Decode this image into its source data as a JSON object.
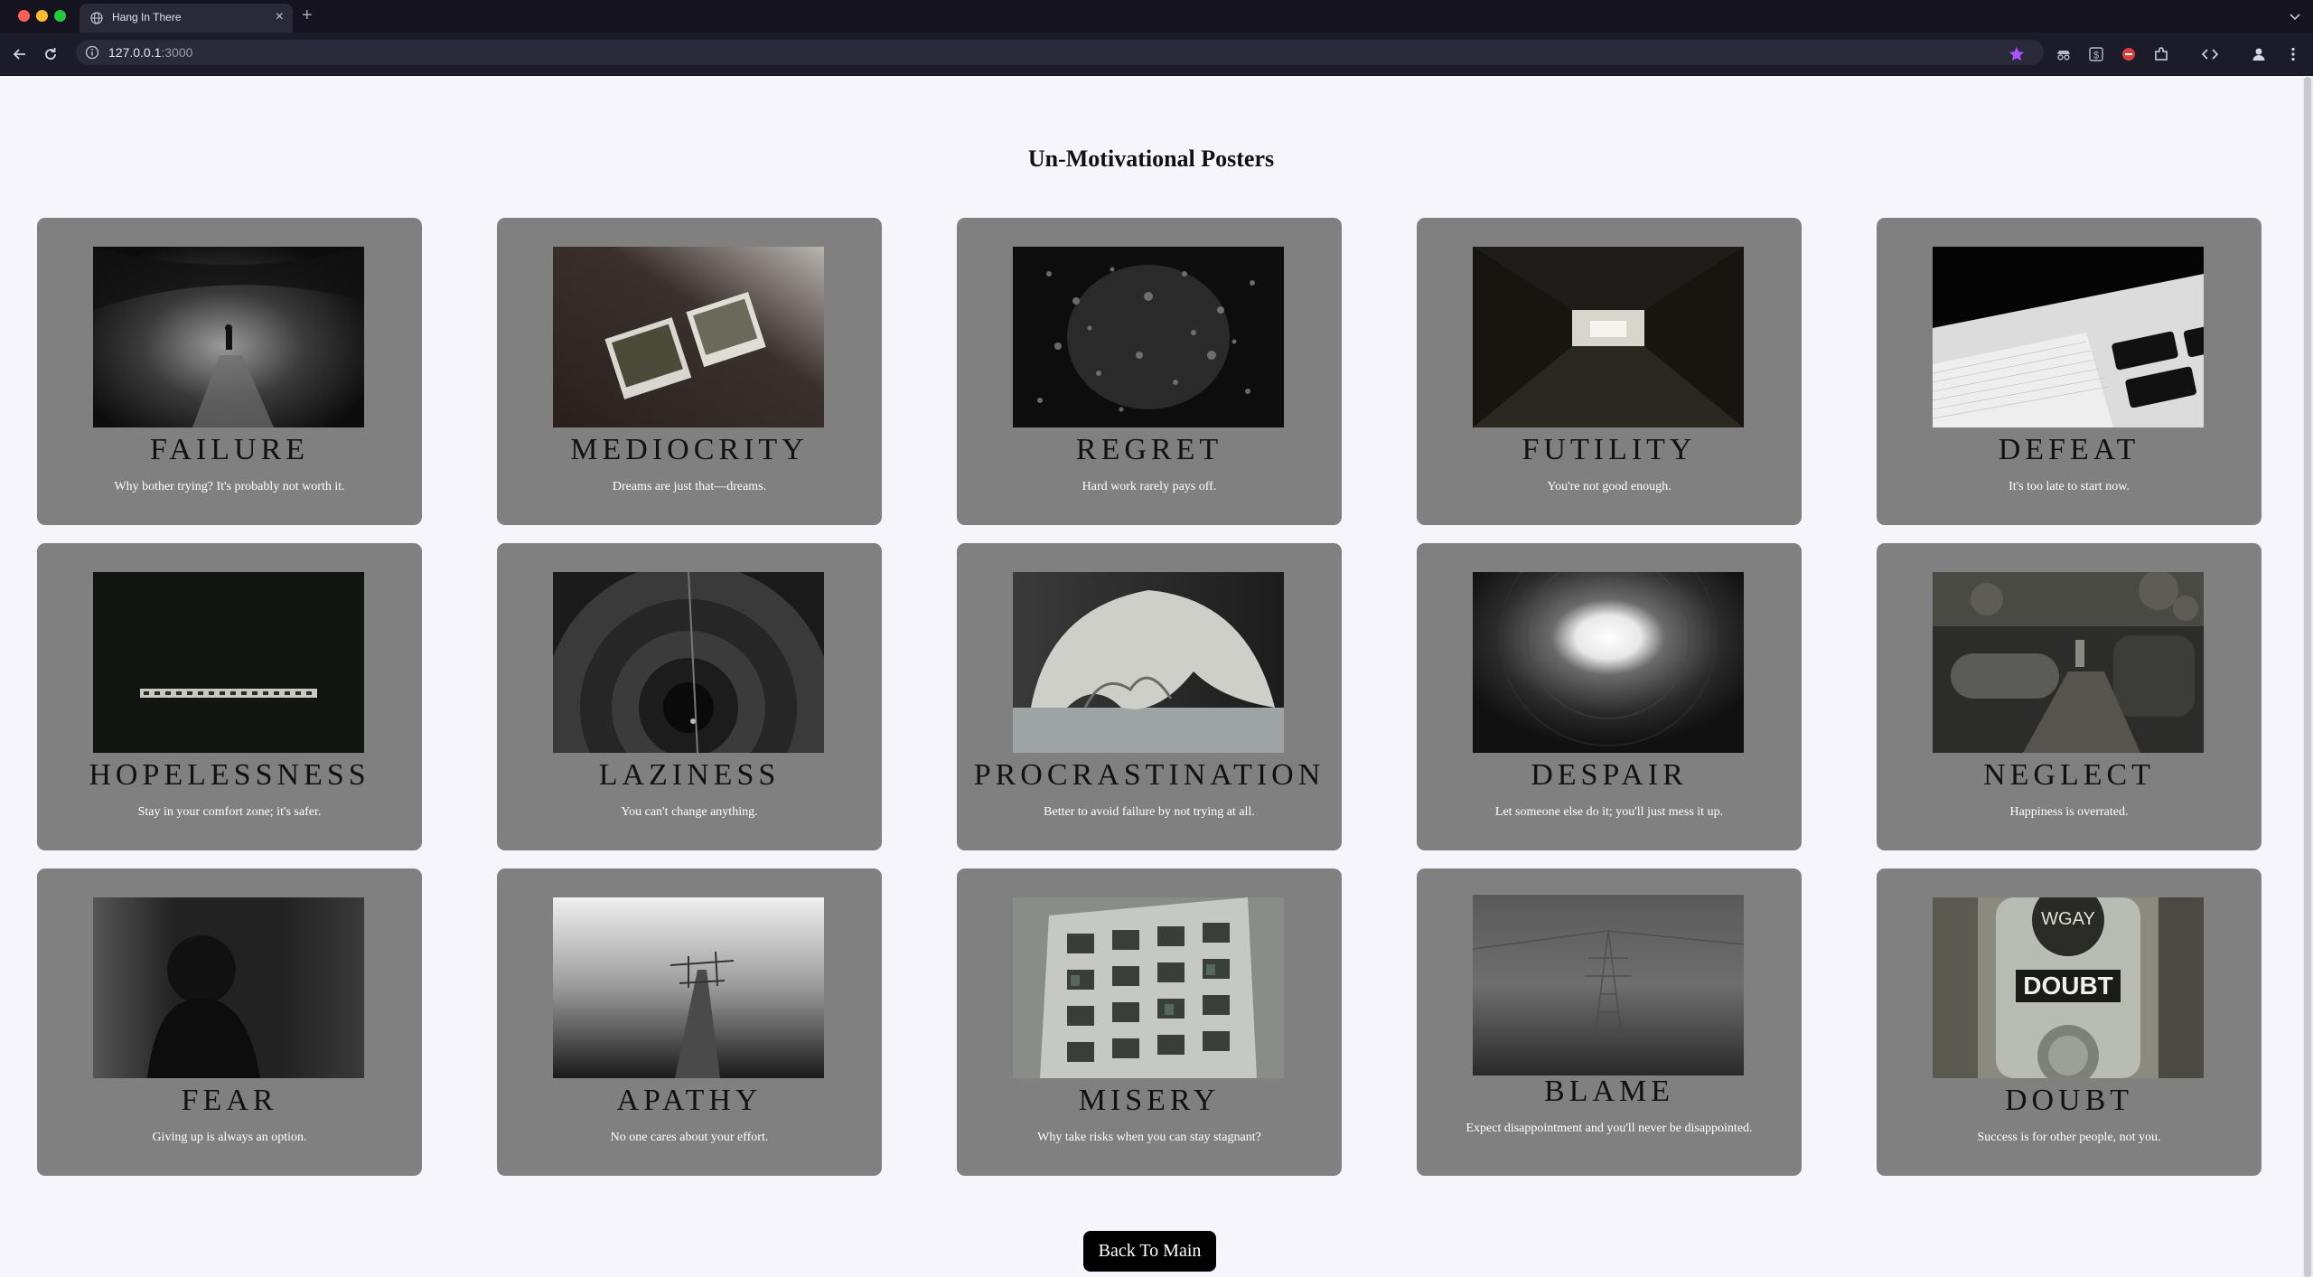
{
  "browser": {
    "tab_title": "Hang In There",
    "url_host": "127.0.0.1",
    "url_port": ":3000",
    "accent_color": "#a855f7"
  },
  "page": {
    "title": "Un-Motivational Posters",
    "back_button_label": "Back To Main"
  },
  "posters": [
    {
      "title": "FAILURE",
      "quote": "Why bother trying? It's probably not worth it.",
      "image": "dark-forest-path"
    },
    {
      "title": "MEDIOCRITY",
      "quote": "Dreams are just that—dreams.",
      "image": "two-polaroids"
    },
    {
      "title": "REGRET",
      "quote": "Hard work rarely pays off.",
      "image": "rain-drops-window"
    },
    {
      "title": "FUTILITY",
      "quote": "You're not good enough.",
      "image": "dark-tunnel"
    },
    {
      "title": "DEFEAT",
      "quote": "It's too late to start now.",
      "image": "laptop-keyboard"
    },
    {
      "title": "HOPELESSNESS",
      "quote": "Stay in your comfort zone; it's safer.",
      "image": "hopelessness-tiles"
    },
    {
      "title": "LAZINESS",
      "quote": "You can't change anything.",
      "image": "spiral-pit"
    },
    {
      "title": "PROCRASTINATION",
      "quote": "Better to avoid failure by not trying at all.",
      "image": "broken-eggshell"
    },
    {
      "title": "DESPAIR",
      "quote": "Let someone else do it; you'll just mess it up.",
      "image": "well-looking-up"
    },
    {
      "title": "NEGLECT",
      "quote": "Happiness is overrated.",
      "image": "abandoned-factory"
    },
    {
      "title": "FEAR",
      "quote": "Giving up is always an option.",
      "image": "shadow-figure"
    },
    {
      "title": "APATHY",
      "quote": "No one cares about your effort.",
      "image": "broken-pier-fog"
    },
    {
      "title": "MISERY",
      "quote": "Why take risks when you can stay stagnant?",
      "image": "decaying-building"
    },
    {
      "title": "BLAME",
      "quote": "Expect disappointment and you'll never be disappointed.",
      "image": "pylon-in-fog"
    },
    {
      "title": "DOUBT",
      "quote": "Success is for other people, not you.",
      "image": "doubt-meter"
    }
  ]
}
